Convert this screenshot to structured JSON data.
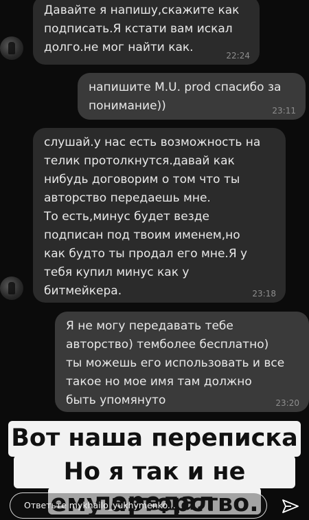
{
  "messages": [
    {
      "text": "Давайте я напишу,скажите как\nподписать.Я кстати вам искал\nдолго.не мог найти как.",
      "time": "22:24"
    },
    {
      "text": "напишите M.U. prod спасибо за\nпонимание))",
      "time": "23:11"
    },
    {
      "text": "слушай.у нас есть возможность на\nтелик протолкнутся.давай как\nнибудь договорим о том что ты\nавторство передаешь мне.\nТо есть,минус будет везде\nподписан под твоим именем,но\nкак будто ты продал его мне.Я у\nтебя купил минус как у\nбитмейкера.",
      "time": "23:18"
    },
    {
      "text": "Я не могу передавать тебе\nавторство) темболее бесплатно)\nты можешь его использовать и все\nтакое но мое имя там должно\nбыть упомянуто",
      "time": "23:20"
    }
  ],
  "caption": {
    "line1": "Вот наша переписка",
    "line2": "Но я так и не передал",
    "line3": "ему авторство."
  },
  "footer": {
    "reply_placeholder": "Ответьте mykhailo_yukhymenko...",
    "send_icon": "send-icon"
  }
}
